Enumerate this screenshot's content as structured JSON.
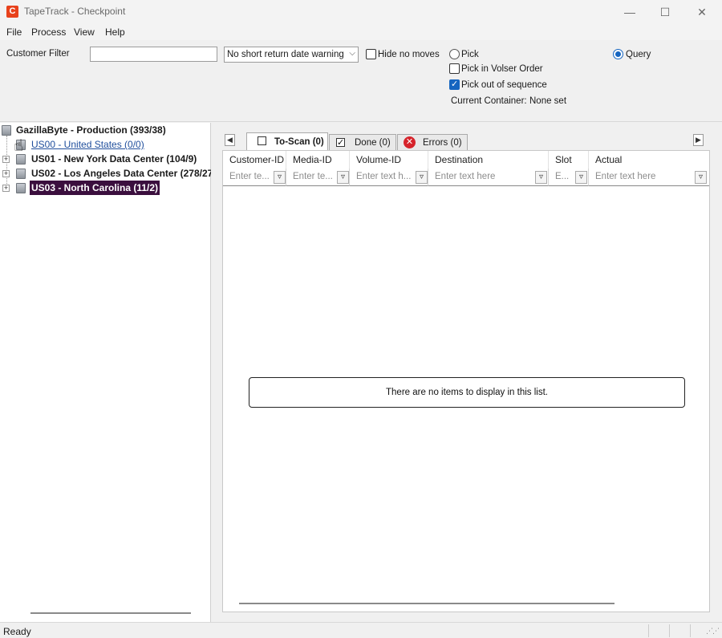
{
  "window": {
    "app_icon": "C",
    "title": "TapeTrack - Checkpoint",
    "minimize": "—",
    "maximize": "☐",
    "close": "✕"
  },
  "menu": [
    "File",
    "Process",
    "View",
    "Help"
  ],
  "toolbar": {
    "customer_filter_label": "Customer Filter",
    "customer_filter_value": "",
    "return_date_select": "No short return date warning",
    "hide_no_moves": {
      "label": "Hide no moves",
      "checked": false
    },
    "pick": {
      "label": "Pick",
      "selected": false
    },
    "pick_in_volser_order": {
      "label": "Pick in Volser Order",
      "checked": false
    },
    "pick_out_of_sequence": {
      "label": "Pick out of sequence",
      "checked": true
    },
    "query": {
      "label": "Query",
      "selected": true
    },
    "current_container_label": "Current Container:",
    "current_container_value": "None set"
  },
  "tree": {
    "root": "GazillaByte - Production (393/38)",
    "items": [
      {
        "label": "US00 - United States (0/0)",
        "style": "link"
      },
      {
        "label": "US01 - New York Data Center (104/9)",
        "style": "bold"
      },
      {
        "label": "US02 - Los Angeles Data Center (278/27",
        "style": "bold"
      },
      {
        "label": "US03 - North Carolina (11/2)",
        "style": "selected"
      }
    ]
  },
  "tabs": [
    {
      "label": "To-Scan (0)",
      "icon": "unchecked-box-icon",
      "active": true
    },
    {
      "label": "Done (0)",
      "icon": "checked-box-icon",
      "active": false
    },
    {
      "label": "Errors (0)",
      "icon": "error-icon",
      "active": false
    }
  ],
  "grid": {
    "columns": [
      {
        "header": "Customer-ID",
        "filter_placeholder": "Enter te..."
      },
      {
        "header": "Media-ID",
        "filter_placeholder": "Enter te..."
      },
      {
        "header": "Volume-ID",
        "filter_placeholder": "Enter text h..."
      },
      {
        "header": "Destination",
        "filter_placeholder": "Enter text here"
      },
      {
        "header": "Slot",
        "filter_placeholder": "E..."
      },
      {
        "header": "Actual",
        "filter_placeholder": "Enter text here"
      }
    ],
    "empty_message": "There are no items to display in this list."
  },
  "status": {
    "text": "Ready"
  },
  "colors": {
    "accent": "#1565c0",
    "selected_tree_bg": "#3b0f3e",
    "error_red": "#d6232b",
    "app_icon": "#e8421c"
  }
}
